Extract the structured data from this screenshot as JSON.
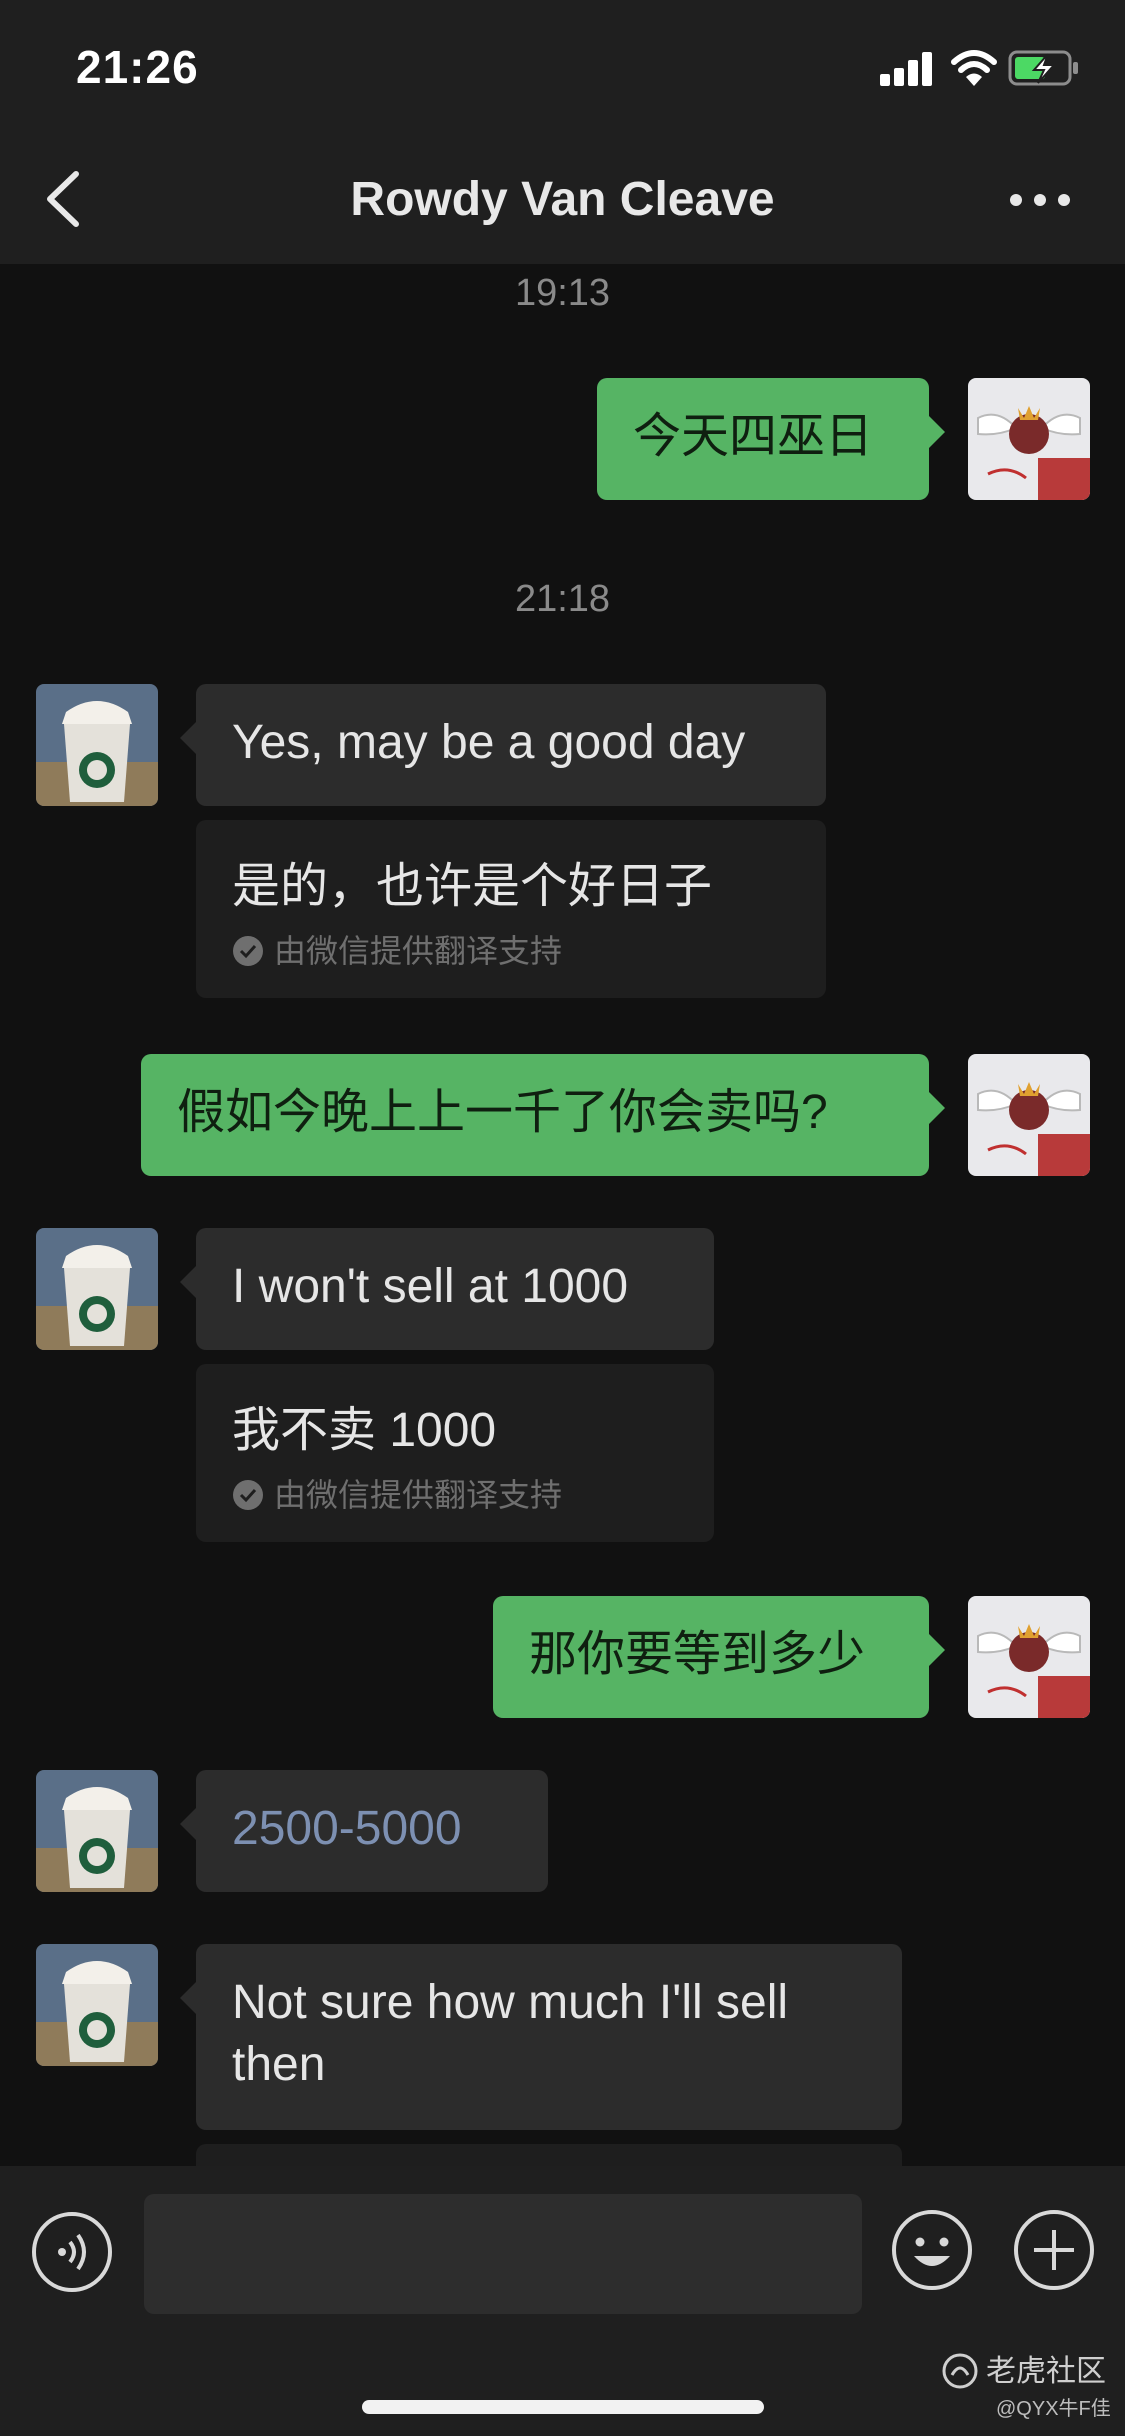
{
  "status_bar": {
    "time": "21:26"
  },
  "header": {
    "title": "Rowdy Van Cleave"
  },
  "chat": {
    "timestamps": [
      "19:13",
      "21:18"
    ],
    "messages": [
      {
        "sender": "self",
        "text": "今天四巫日"
      },
      {
        "sender": "other",
        "text": "Yes, may be a good day",
        "translation": "是的，也许是个好日子"
      },
      {
        "sender": "self",
        "text": "假如今晚上上一千了你会卖吗?"
      },
      {
        "sender": "other",
        "text": "I won't sell at 1000",
        "translation": "我不卖 1000"
      },
      {
        "sender": "self",
        "text": "那你要等到多少"
      },
      {
        "sender": "other",
        "text": "2500-5000"
      },
      {
        "sender": "other",
        "text": "Not sure how much I'll sell then"
      }
    ],
    "translation_credit": "由微信提供翻译支持"
  },
  "watermark": {
    "brand": "老虎社区",
    "user": "@QYX牛F佳"
  },
  "colors": {
    "self_bubble": "#56b464",
    "other_bubble": "#2c2c2c",
    "link_text": "#7d90b2",
    "background": "#111111",
    "bar_background": "#1f1f1f"
  },
  "icons": {
    "back": "chevron-left-icon",
    "more": "more-dots-icon",
    "voice": "voice-icon",
    "emoji": "emoji-icon",
    "add": "plus-circle-icon"
  }
}
